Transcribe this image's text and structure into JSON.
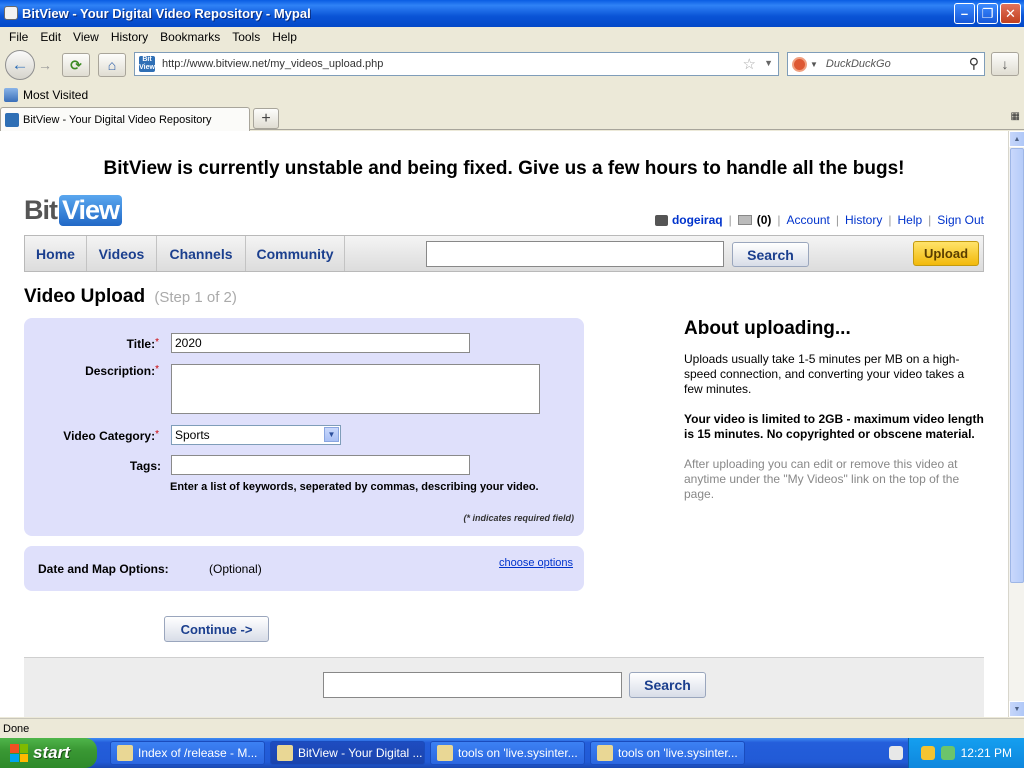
{
  "window": {
    "title": "BitView - Your Digital Video Repository - Mypal"
  },
  "menu": [
    "File",
    "Edit",
    "View",
    "History",
    "Bookmarks",
    "Tools",
    "Help"
  ],
  "urlbar": {
    "url": "http://www.bitview.net/my_videos_upload.php",
    "favicon_text": "Bit View"
  },
  "search_engine": {
    "placeholder": "DuckDuckGo"
  },
  "bookmarks": {
    "most_visited": "Most Visited"
  },
  "tab": {
    "label": "BitView - Your Digital Video Repository"
  },
  "page": {
    "banner": "BitView is currently unstable and being fixed. Give us a few hours to handle all the bugs!",
    "logo": {
      "part1": "Bit",
      "part2": "View"
    },
    "user": {
      "username": "dogeiraq",
      "message_count": "(0)",
      "links": [
        "Account",
        "History",
        "Help",
        "Sign Out"
      ]
    },
    "nav": {
      "items": [
        "Home",
        "Videos",
        "Channels",
        "Community"
      ],
      "search_button": "Search",
      "upload_button": "Upload"
    },
    "heading": "Video Upload",
    "step": "(Step 1 of 2)",
    "form": {
      "title_label": "Title:",
      "title_value": "2020",
      "description_label": "Description:",
      "description_value": "",
      "category_label": "Video Category:",
      "category_value": "Sports",
      "tags_label": "Tags:",
      "tags_value": "",
      "required_marker": "*",
      "tags_hint": "Enter a list of keywords, seperated by commas, describing your video.",
      "required_note": "(* indicates required field)"
    },
    "date_map": {
      "label": "Date and Map Options:",
      "optional": "(Optional)",
      "link": "choose options"
    },
    "continue_button": "Continue ->",
    "footer": {
      "search_button": "Search"
    },
    "about": {
      "title": "About uploading...",
      "p1": "Uploads usually take 1-5 minutes per MB on a high-speed connection, and converting your video takes a few minutes.",
      "p2": "Your video is limited to 2GB - maximum video length is 15 minutes. No copyrighted or obscene material.",
      "p3": "After uploading you can edit or remove this video at anytime under the \"My Videos\" link on the top of the page."
    }
  },
  "statusbar": {
    "text": "Done"
  },
  "taskbar": {
    "start": "start",
    "tasks": [
      "Index of /release - M...",
      "BitView - Your Digital ...",
      "tools on 'live.sysinter...",
      "tools on 'live.sysinter..."
    ],
    "clock": "12:21 PM"
  },
  "colors": {
    "form_bg": "#dfe0fb",
    "link": "#0033cc",
    "nav_text": "#1b3f8e",
    "upload_btn": "#f2b90b"
  }
}
